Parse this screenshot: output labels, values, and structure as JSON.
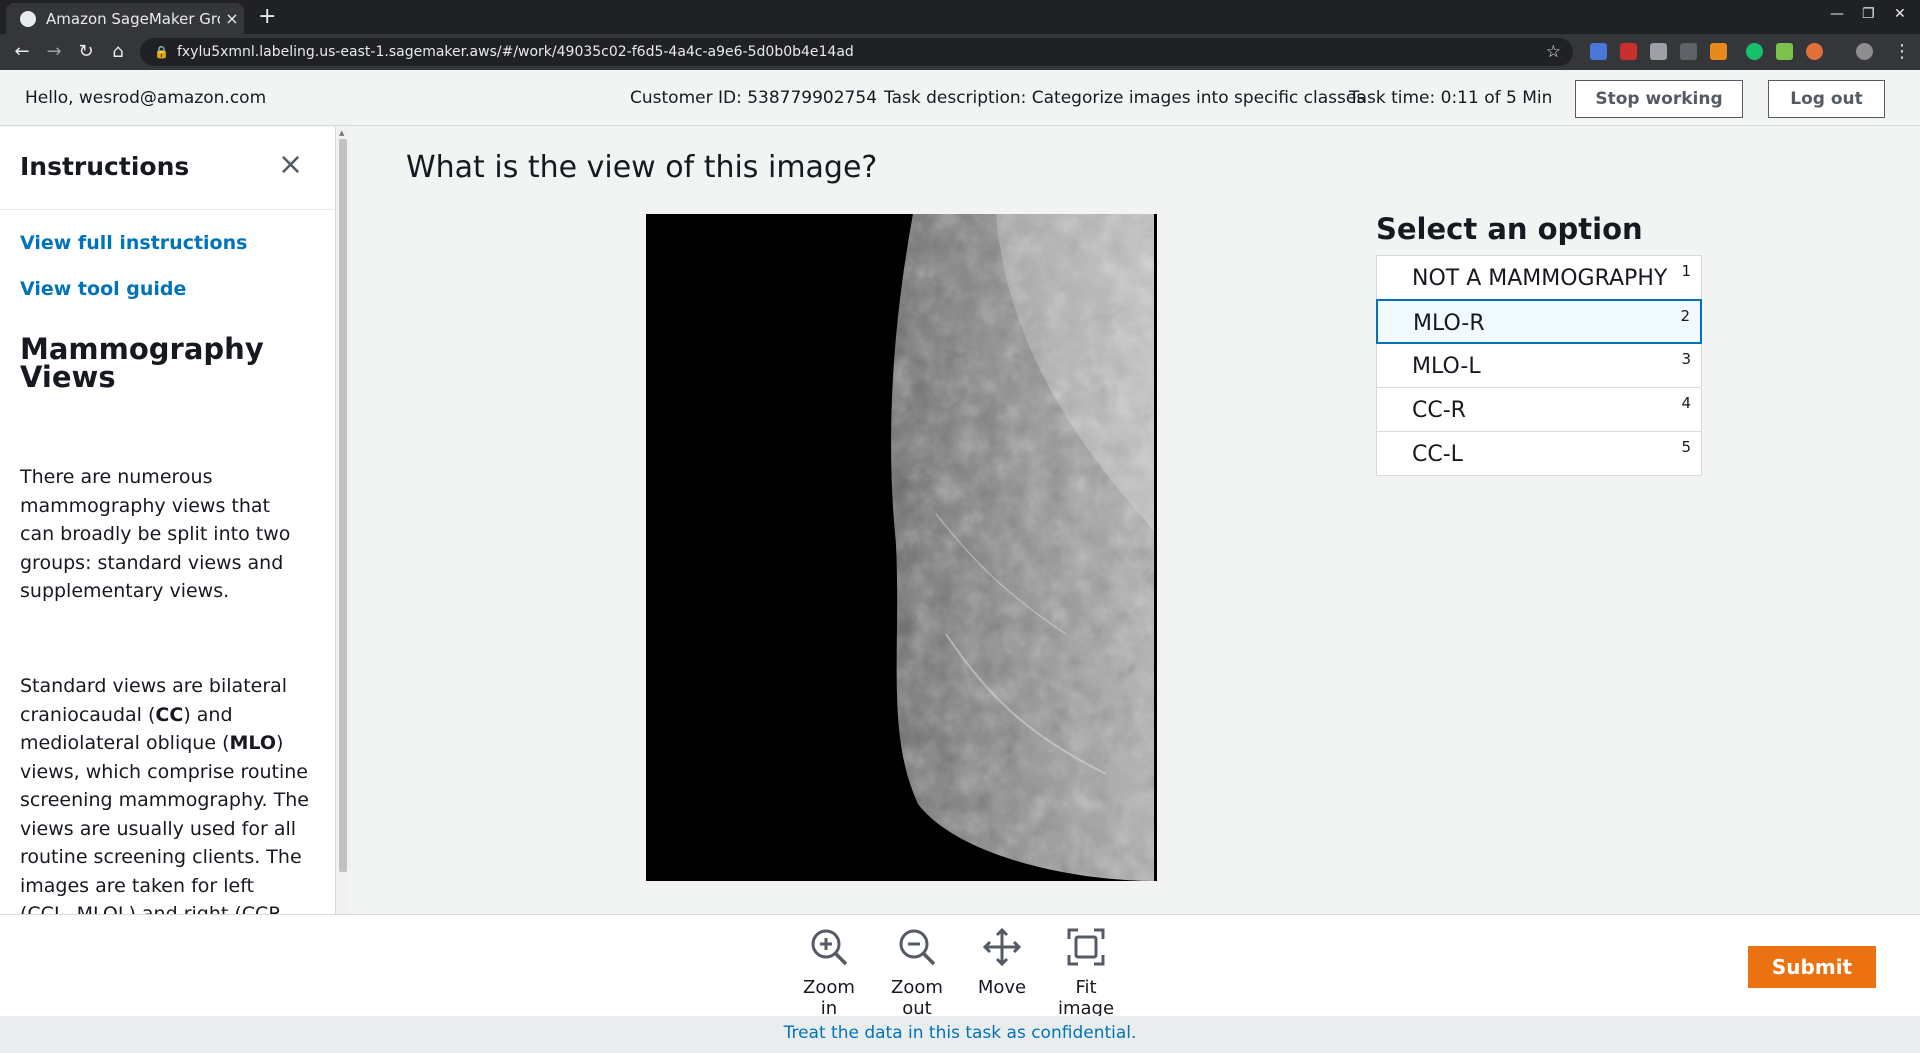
{
  "browser": {
    "tab_title": "Amazon SageMaker Gro",
    "tab_close": "×",
    "new_tab": "+",
    "url": "fxylu5xmnl.labeling.us-east-1.sagemaker.aws/#/work/49035c02-f6d5-4a4c-a9e6-5d0b0b4e14ad",
    "icons": [
      "back-icon",
      "forward-icon",
      "reload-icon",
      "home-icon",
      "lock-icon",
      "star-icon"
    ]
  },
  "header": {
    "greeting": "Hello, wesrod@amazon.com",
    "customer_id": "Customer ID: 538779902754",
    "task_description": "Task description: Categorize images into specific classes",
    "task_time": "Task time: 0:11 of 5 Min",
    "stop_label": "Stop working",
    "logout_label": "Log out"
  },
  "sidebar": {
    "title": "Instructions",
    "close": "×",
    "link_full": "View full instructions",
    "link_tool": "View tool guide",
    "heading": "Mammography Views",
    "para1": "There are numerous mammography views that can broadly be split into two groups: standard views and supplementary views.",
    "para2_a": "Standard views are bilateral craniocaudal (",
    "para2_b": "CC",
    "para2_c": ") and mediolateral oblique (",
    "para2_d": "MLO",
    "para2_e": ") views, which comprise routine screening mammography. The views are usually used for all routine screening clients. The images are taken for left (CCL, MLOL) and right (CCR"
  },
  "main": {
    "question": "What is the view of this image?",
    "options_title": "Select an option",
    "options": [
      {
        "label": "NOT A MAMMOGRAPHY",
        "key": "1"
      },
      {
        "label": "MLO-R",
        "key": "2"
      },
      {
        "label": "MLO-L",
        "key": "3"
      },
      {
        "label": "CC-R",
        "key": "4"
      },
      {
        "label": "CC-L",
        "key": "5"
      }
    ],
    "selected_option": "MLO-R"
  },
  "toolbar": {
    "zoom_in": "Zoom in",
    "zoom_out": "Zoom out",
    "move": "Move",
    "fit": "Fit image",
    "submit": "Submit"
  },
  "footer": {
    "note": "Treat the data in this task as confidential."
  },
  "colors": {
    "accent": "#0073bb",
    "submit": "#ec7211"
  }
}
